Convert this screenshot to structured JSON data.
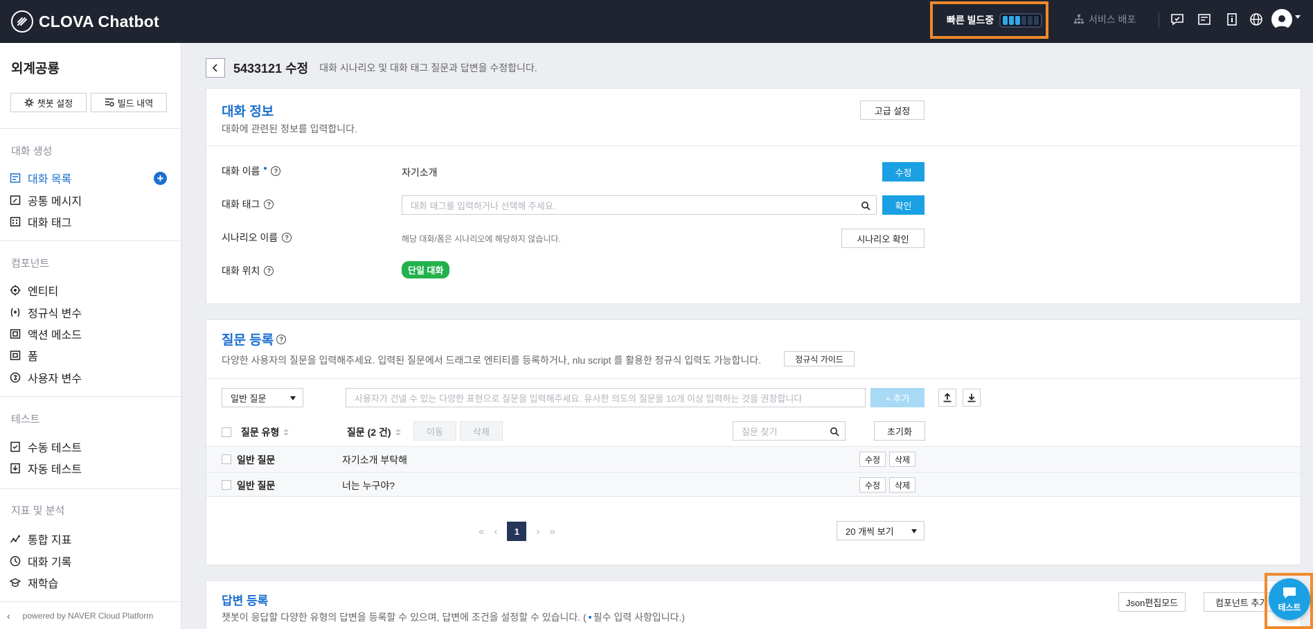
{
  "header": {
    "brand": "CLOVA Chatbot",
    "build_status": "빠른 빌드중",
    "build_progress": 0.4,
    "deploy": "서비스 배포",
    "icons": [
      "feedback-icon",
      "notice-icon",
      "guide-icon",
      "language-icon",
      "account-icon"
    ]
  },
  "sidebar": {
    "title": "외계공룡",
    "settings_btn": "챗봇 설정",
    "build_history_btn": "빌드 내역",
    "sections": [
      {
        "label": "대화 생성",
        "items": [
          "대화 목록",
          "공통 메시지",
          "대화 태그"
        ]
      },
      {
        "label": "컴포넌트",
        "items": [
          "엔티티",
          "정규식 변수",
          "액션 메소드",
          "폼",
          "사용자 변수"
        ]
      },
      {
        "label": "테스트",
        "items": [
          "수동 테스트",
          "자동 테스트"
        ]
      },
      {
        "label": "지표 및 분석",
        "items": [
          "통합 지표",
          "대화 기록",
          "재학습"
        ]
      }
    ],
    "footer": "powered by NAVER Cloud Platform"
  },
  "page": {
    "title": "5433121 수정",
    "desc": "대화 시나리오 및 대화 태그 질문과 답변을 수정합니다."
  },
  "info": {
    "title": "대화 정보",
    "sub": "대화에 관련된 정보를 입력합니다.",
    "advanced_btn": "고급 설정",
    "name_label": "대화 이름",
    "name_value": "자기소개",
    "edit_btn": "수정",
    "tag_label": "대화 태그",
    "tag_placeholder": "대화 태그를 입력하거나 선택해 주세요.",
    "confirm_btn": "확인",
    "scenario_label": "시나리오 이름",
    "scenario_note": "해당 대화/폼은 시나리오에 해당하지 않습니다.",
    "scenario_btn": "시나리오 확인",
    "position_label": "대화 위치",
    "position_badge": "단일 대화"
  },
  "questions": {
    "title": "질문 등록",
    "sub": "다양한 사용자의 질문을 입력해주세요. 입력된 질문에서 드래그로 엔티티를 등록하거나, nlu script 를 활용한 정규식 입력도 가능합니다.",
    "regex_guide_btn": "정규식 가이드",
    "type_select": "일반 질문",
    "input_placeholder": "사용자가 건넬 수 있는 다양한 표현으로 질문을 입력해주세요. 유사한 의도의 질문을 10개 이상 입력하는 것을 권장합니다",
    "add_btn": "+ 추가",
    "col_type": "질문 유형",
    "col_question": "질문 (2 건)",
    "move_btn": "이동",
    "delete_btn": "삭제",
    "search_placeholder": "질문 찾기",
    "reset_btn": "초기화",
    "rows": [
      {
        "type": "일반 질문",
        "text": "자기소개 부탁해",
        "edit": "수정",
        "delete": "삭제"
      },
      {
        "type": "일반 질문",
        "text": "너는 누구야?",
        "edit": "수정",
        "delete": "삭제"
      }
    ],
    "pager_first": "«",
    "pager_prev": "‹",
    "pager_next": "›",
    "pager_last": "»",
    "current_page": "1",
    "page_size": "20 개씩 보기"
  },
  "answers": {
    "title": "답변 등록",
    "sub": "챗봇이 응답할 다양한 유형의 답변을 등록할 수 있으며, 답변에 조건을 설정할 수 있습니다. (",
    "sub_tail": "필수 입력 사항입니다.)",
    "json_btn": "Json편집모드",
    "component_btn": "컴포넌트 추가"
  },
  "chat": {
    "label": "테스트"
  },
  "colors": {
    "accent": "#1b6fd1",
    "button": "#1aa0e3",
    "header": "#1f2430",
    "highlight": "#f08a2c",
    "badge": "#22b14c"
  }
}
